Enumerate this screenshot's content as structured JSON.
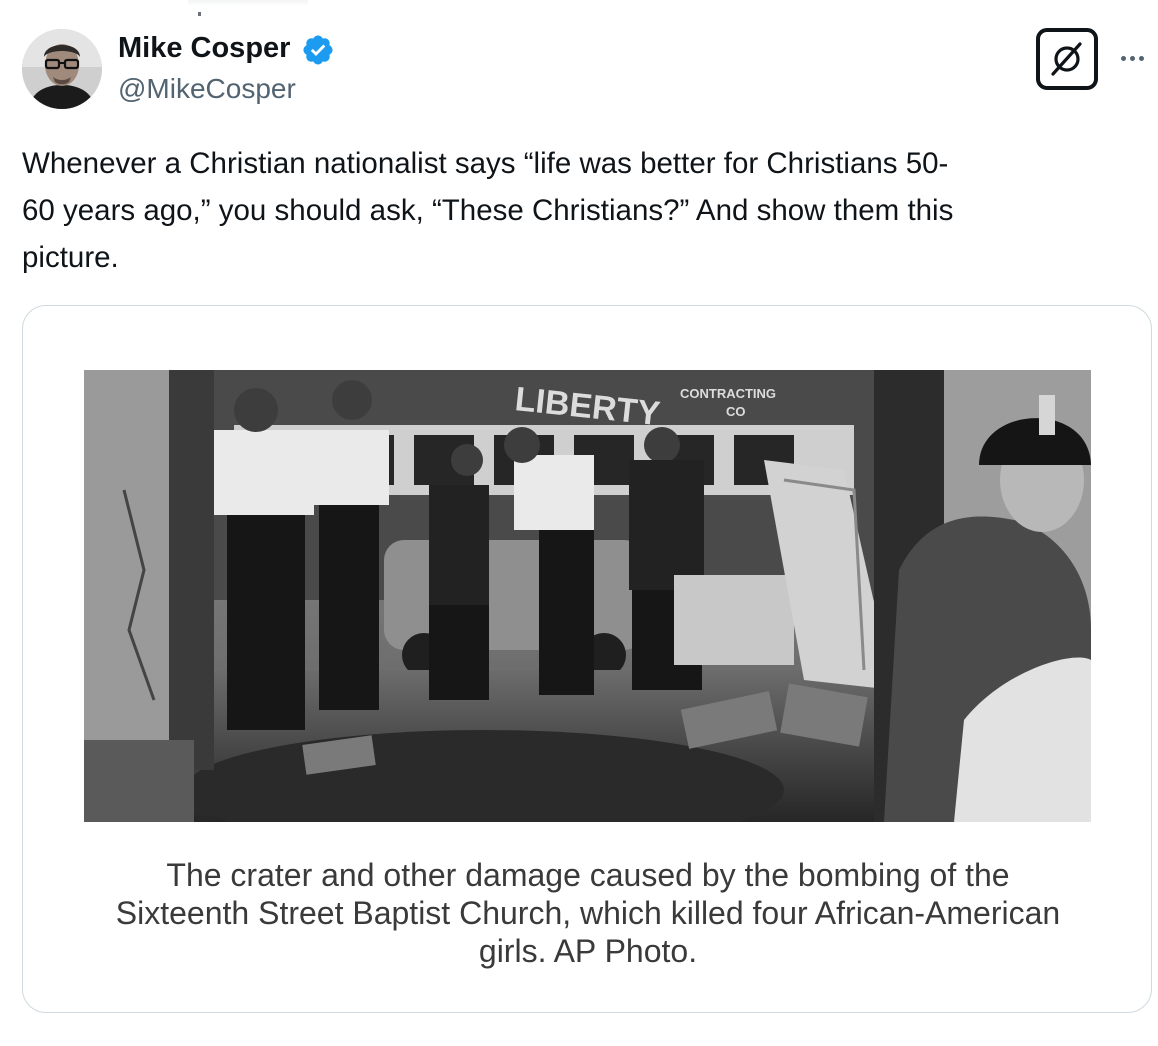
{
  "author": {
    "display_name": "Mike Cosper",
    "handle": "@MikeCosper",
    "verified": true,
    "avatar_icon": "avatar-photo"
  },
  "actions": {
    "grok_icon": "grok-icon",
    "more_icon": "more-icon"
  },
  "tweet": {
    "text": "Whenever a Christian nationalist says “life was better for Christians 50-\n60 years ago,” you should ask, “These Christians?” And show them this\npicture."
  },
  "media": {
    "photo_signage": [
      "LIBERTY",
      "CONTRACTING",
      "CO"
    ],
    "caption": "The crater and other damage caused by the bombing of the\nSixteenth Street Baptist Church, which killed four African-American\ngirls. AP Photo."
  },
  "colors": {
    "verified_blue": "#1d9bf0",
    "text_primary": "#0f1419",
    "text_secondary": "#536471",
    "card_border": "#cfd9de"
  }
}
